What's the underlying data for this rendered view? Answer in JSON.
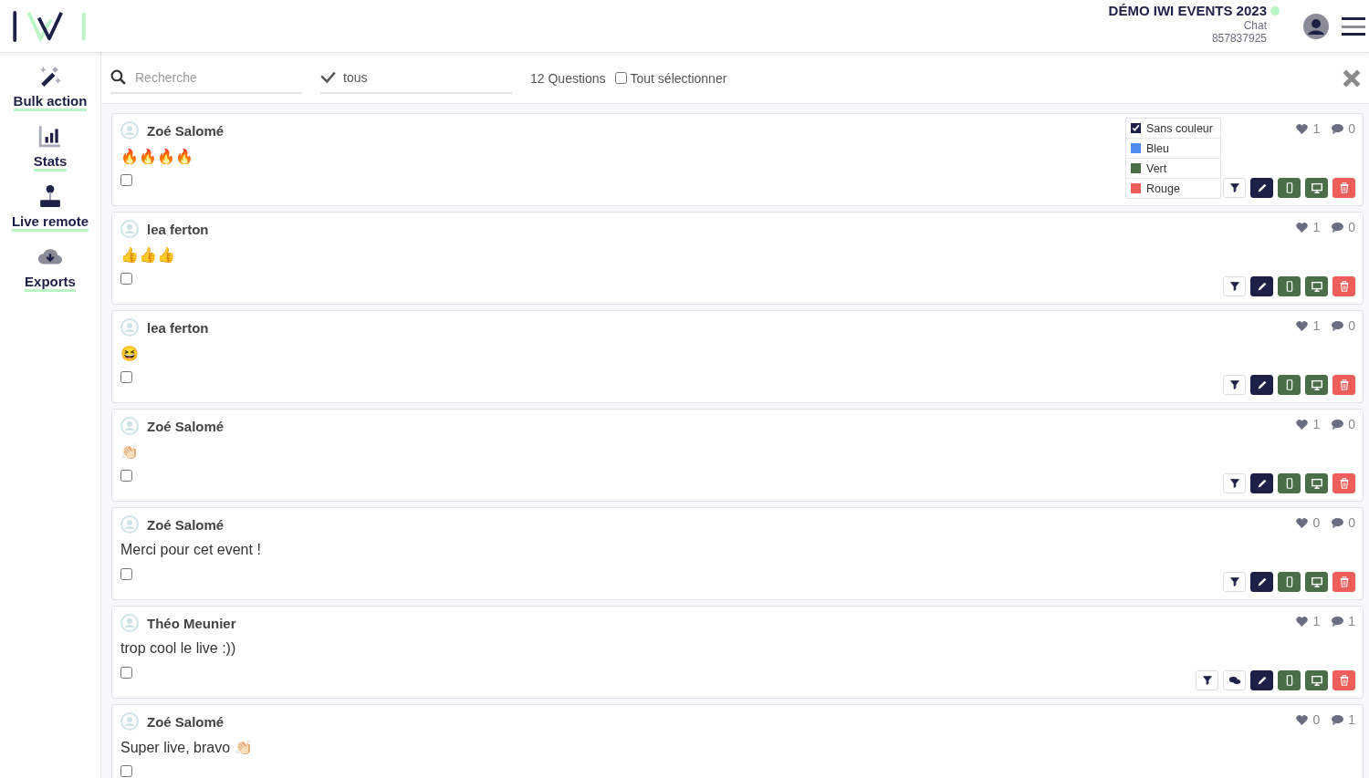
{
  "header": {
    "event_title": "DÉMO IWI EVENTS 2023",
    "online": true,
    "module": "Chat",
    "code": "857837925"
  },
  "sidebar": {
    "items": [
      {
        "kind": "bulk",
        "label": "Bulk action"
      },
      {
        "kind": "stats",
        "label": "Stats"
      },
      {
        "kind": "remote",
        "label": "Live remote"
      },
      {
        "kind": "exports",
        "label": "Exports"
      }
    ]
  },
  "toolbar": {
    "search": {
      "placeholder": "Recherche"
    },
    "filter": {
      "value": "tous"
    },
    "count": "12 Questions",
    "select_all": {
      "label": "Tout sélectionner",
      "checked": false
    }
  },
  "questions": [
    {
      "author": "Zoé Salomé",
      "text": "🔥🔥🔥🔥",
      "checked": false,
      "likes": "1",
      "comments": "0",
      "actions": [
        {
          "kind": "filter"
        },
        {
          "kind": "edit"
        },
        {
          "kind": "mobile"
        },
        {
          "kind": "screen"
        },
        {
          "kind": "delete"
        }
      ],
      "color_menu": [
        {
          "label": "Sans couleur",
          "color": "#1e2147",
          "selected": true
        },
        {
          "label": "Bleu",
          "color": "#4f8def",
          "selected": false
        },
        {
          "label": "Vert",
          "color": "#4a6e48",
          "selected": false
        },
        {
          "label": "Rouge",
          "color": "#ee5f5b",
          "selected": false
        }
      ]
    },
    {
      "author": "lea ferton",
      "text": "👍👍👍",
      "checked": false,
      "likes": "1",
      "comments": "0",
      "actions": [
        {
          "kind": "filter"
        },
        {
          "kind": "edit"
        },
        {
          "kind": "mobile"
        },
        {
          "kind": "screen"
        },
        {
          "kind": "delete"
        }
      ]
    },
    {
      "author": "lea ferton",
      "text": "😆",
      "checked": false,
      "likes": "1",
      "comments": "0",
      "actions": [
        {
          "kind": "filter"
        },
        {
          "kind": "edit"
        },
        {
          "kind": "mobile"
        },
        {
          "kind": "screen"
        },
        {
          "kind": "delete"
        }
      ]
    },
    {
      "author": "Zoé Salomé",
      "text": "👏🏻",
      "checked": false,
      "likes": "1",
      "comments": "0",
      "actions": [
        {
          "kind": "filter"
        },
        {
          "kind": "edit"
        },
        {
          "kind": "mobile"
        },
        {
          "kind": "screen"
        },
        {
          "kind": "delete"
        }
      ]
    },
    {
      "author": "Zoé Salomé",
      "text": "Merci pour cet event !",
      "checked": false,
      "likes": "0",
      "comments": "0",
      "actions": [
        {
          "kind": "filter"
        },
        {
          "kind": "edit"
        },
        {
          "kind": "mobile"
        },
        {
          "kind": "screen"
        },
        {
          "kind": "delete"
        }
      ]
    },
    {
      "author": "Théo Meunier",
      "text": "trop cool le live :))",
      "checked": false,
      "likes": "1",
      "comments": "1",
      "actions": [
        {
          "kind": "filter"
        },
        {
          "kind": "reply"
        },
        {
          "kind": "edit"
        },
        {
          "kind": "mobile"
        },
        {
          "kind": "screen"
        },
        {
          "kind": "delete"
        }
      ]
    },
    {
      "author": "Zoé Salomé",
      "text": "Super live, bravo 👏🏻",
      "checked": false,
      "likes": "0",
      "comments": "1"
    }
  ]
}
